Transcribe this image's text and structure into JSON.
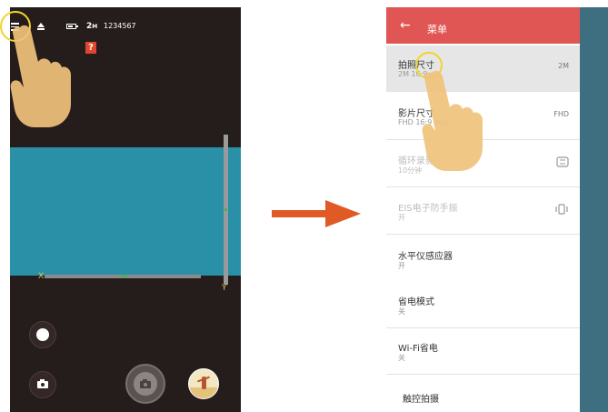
{
  "camera": {
    "resolution_main": "2",
    "resolution_sub": "M",
    "device_id": "1234567",
    "help_badge": "?",
    "level_x_mark": "X",
    "level_y_mark": "Y"
  },
  "settings_menu": {
    "title": "菜单",
    "back_glyph": "←",
    "items": [
      {
        "title": "拍照尺寸",
        "value": "2M 16:9",
        "icon": "2M",
        "state": "selected"
      },
      {
        "title": "影片尺寸",
        "value": "FHD 16:9 30p",
        "icon": "FHD",
        "state": "normal"
      },
      {
        "title": "循环录影",
        "value": "10分钟",
        "icon": "loop-icon",
        "state": "disabled"
      },
      {
        "title": "EIS电子防手振",
        "value": "开",
        "icon": "eis-icon",
        "state": "disabled"
      },
      {
        "title": "水平仪感应器",
        "value": "开",
        "icon": "",
        "state": "normal"
      },
      {
        "title": "省电模式",
        "value": "关",
        "icon": "",
        "state": "normal"
      },
      {
        "title": "Wi-Fi省电",
        "value": "关",
        "icon": "",
        "state": "normal"
      },
      {
        "title": "触控拍摄",
        "value": "",
        "icon": "",
        "state": "normal"
      }
    ]
  },
  "colors": {
    "header_red": "#e05654",
    "arrow_orange": "#e05a25",
    "preview_blue": "#2a90a7",
    "highlight_yellow": "#f2d42c",
    "camera_bg": "#251d1c"
  }
}
